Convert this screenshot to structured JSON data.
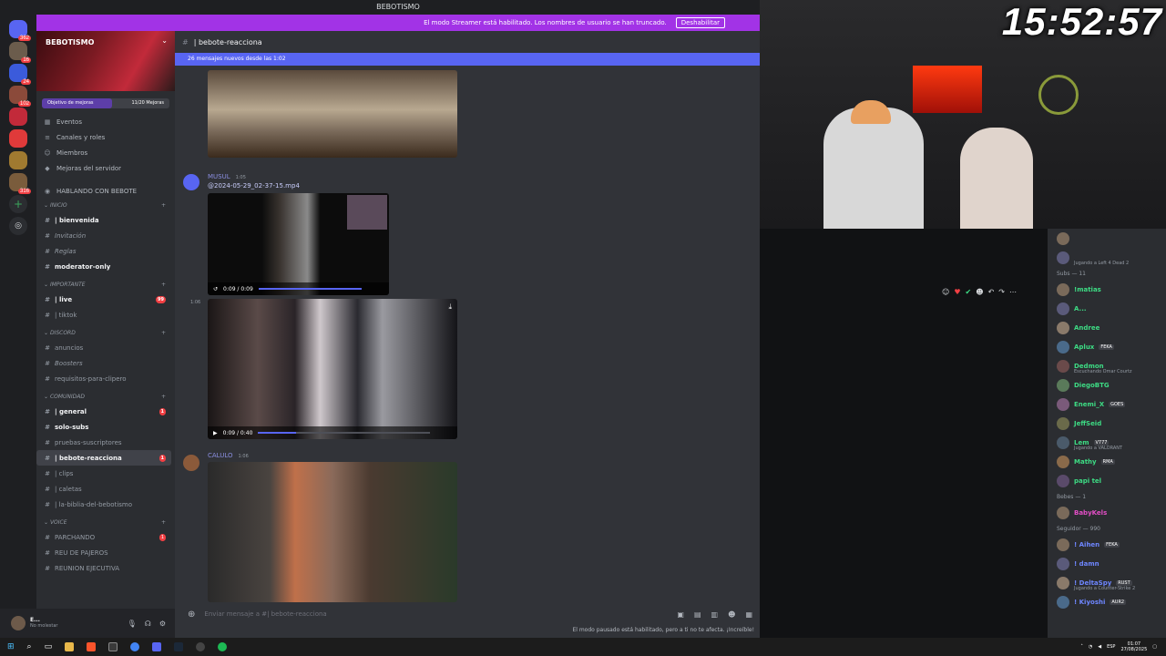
{
  "clock": "15:52:57",
  "window_title": "BEBOTISMO",
  "streamer_bar": {
    "text": "El modo Streamer está habilitado. Los nombres de usuario se han truncado.",
    "button": "Deshabilitar"
  },
  "server": {
    "name": "BEBOTISMO",
    "boost_goal": "Objetivo de mejoras",
    "boost_count": "11/20 Mejoras",
    "boost_progress": 0.55,
    "nav": [
      "Eventos",
      "Canales y roles",
      "Miembros",
      "Mejoras del servidor"
    ],
    "hablando": "HABLANDO CON BEBOTE"
  },
  "rail_badges": [
    "362",
    "16",
    "24",
    "102",
    "316"
  ],
  "categories": {
    "inicio": "INICIO",
    "importante": "IMPORTANTE",
    "discord": "DISCORD",
    "comunidad": "COMUNIDAD",
    "voice": "VOICE"
  },
  "channels": {
    "inicio": [
      {
        "label": "| bienvenida",
        "bold": true
      },
      {
        "label": "Invitación",
        "italic": true
      },
      {
        "label": "Reglas",
        "italic": true
      },
      {
        "label": "moderator-only",
        "bold": true
      }
    ],
    "importante": [
      {
        "label": "| live",
        "bold": true,
        "badge": "99"
      },
      {
        "label": "| tiktok"
      }
    ],
    "discord": [
      {
        "label": "anuncios"
      },
      {
        "label": "Boosters",
        "italic": true
      },
      {
        "label": "requisitos-para-clipero"
      }
    ],
    "comunidad": [
      {
        "label": "| general",
        "bold": true,
        "badge": "1"
      },
      {
        "label": "solo-subs",
        "bold": true
      },
      {
        "label": "pruebas-suscriptores"
      },
      {
        "label": "| bebote-reacciona",
        "bold": true,
        "badge": "1",
        "active": true
      },
      {
        "label": "| clips"
      },
      {
        "label": "| caletas"
      },
      {
        "label": "| la-biblia-del-bebotismo"
      }
    ],
    "voice": [
      {
        "label": "PARCHANDO",
        "badge": "1"
      },
      {
        "label": "REU DE PAJEROS"
      },
      {
        "label": "REUNION EJECUTIVA"
      }
    ]
  },
  "user": {
    "name": "E...",
    "status": "No molestar"
  },
  "chat": {
    "channel_title": "| bebote-reacciona",
    "new_messages": "26 mensajes nuevos desde las 1:02",
    "msg1_author": "MUSUL",
    "msg1_time": "1:05",
    "msg1_file": "@2024-05-29_02-37-15.mp4",
    "video1_time": "0:09 / 0:09",
    "video1_progress": 1.0,
    "msg2_time": "1:06",
    "video2_time": "0:09 / 0:40",
    "video2_progress": 0.22,
    "msg3_author": "CALULO",
    "msg3_time": "1:06",
    "composer_placeholder": "Enviar mensaje a #",
    "composer_channel": "| bebote-reacciona",
    "paused_note": "El modo pausado está habilitado, pero a ti no te afecta. ¡Increíble!"
  },
  "members": {
    "top": [
      {
        "name": "",
        "color": "pink"
      },
      {
        "name": "",
        "sub": "Jugando a Left 4 Dead 2",
        "color": "pink"
      }
    ],
    "subs_header": "Subs — 11",
    "subs": [
      {
        "name": "!matias"
      },
      {
        "name": "A..."
      },
      {
        "name": "Andree"
      },
      {
        "name": "Aplux",
        "tag": "FEKA"
      },
      {
        "name": "Dedmon",
        "sub": "Escuchando Omar Courtz"
      },
      {
        "name": "DiegoBTG"
      },
      {
        "name": "Enemi_X",
        "tag": "GOES"
      },
      {
        "name": "JeffSeid"
      },
      {
        "name": "Lem",
        "tag": "V777",
        "sub": "Jugando a VALORANT"
      },
      {
        "name": "Mathy",
        "tag": "RMA"
      },
      {
        "name": "papi tel"
      }
    ],
    "bebes_header": "Bebes — 1",
    "bebes": [
      {
        "name": "BabyKels"
      }
    ],
    "seguidor_header": "Seguidor — 990",
    "seguidores": [
      {
        "name": "! Aihen",
        "tag": "FEKA"
      },
      {
        "name": "! damn"
      },
      {
        "name": "! DeltaSpy",
        "tag": "RUST",
        "sub": "Jugando a Counter-Strike 2"
      },
      {
        "name": "! Kiyoshi",
        "tag": "AUR2"
      }
    ]
  },
  "taskbar": {
    "lang": "ESP",
    "time": "01:07",
    "date": "27/08/2025"
  },
  "colors": {
    "accent": "#5865f2",
    "streamer": "#a233e6",
    "unread": "#f23f43",
    "online": "#3ddc84"
  }
}
